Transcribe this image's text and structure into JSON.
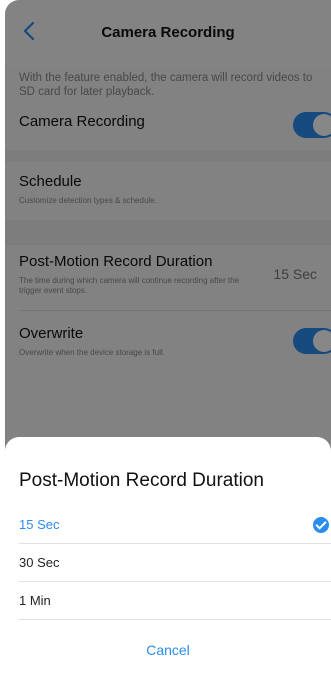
{
  "header": {
    "title": "Camera Recording"
  },
  "intro": "With the feature enabled, the camera will record videos to SD card for later playback.",
  "settings": {
    "camera_recording": {
      "label": "Camera Recording",
      "enabled": true
    },
    "schedule": {
      "label": "Schedule",
      "sub": "Customize detection types & schedule."
    },
    "post_motion": {
      "label": "Post-Motion Record Duration",
      "sub": "The time during which camera will continue recording after the trigger event stops.",
      "value": "15 Sec"
    },
    "overwrite": {
      "label": "Overwrite",
      "sub": "Overwrite when the device storage is full.",
      "enabled": true
    }
  },
  "sheet": {
    "title": "Post-Motion Record Duration",
    "options": [
      "15 Sec",
      "30 Sec",
      "1 Min"
    ],
    "selected": "15 Sec",
    "cancel": "Cancel"
  },
  "colors": {
    "accent": "#2b8cf0"
  }
}
